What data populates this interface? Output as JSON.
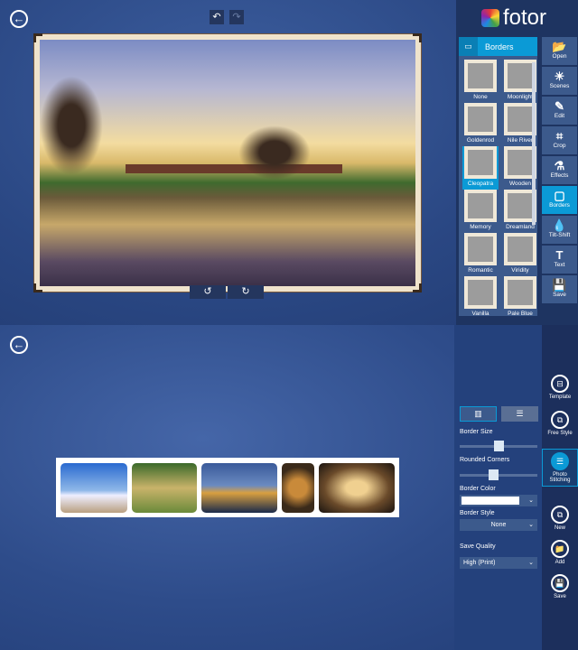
{
  "top": {
    "back_icon": "arrow-left",
    "brand": "fotor",
    "panel_title": "Borders",
    "borders": [
      {
        "label": "None"
      },
      {
        "label": "Moonlight"
      },
      {
        "label": "Goldenrod"
      },
      {
        "label": "Nile River"
      },
      {
        "label": "Cleopatra",
        "selected": true
      },
      {
        "label": "Wooden"
      },
      {
        "label": "Memory"
      },
      {
        "label": "Dreamland"
      },
      {
        "label": "Romantic"
      },
      {
        "label": "Viridity"
      },
      {
        "label": "Vanilla"
      },
      {
        "label": "Pale Blue"
      }
    ],
    "tools": [
      {
        "label": "Open",
        "icon": "📂"
      },
      {
        "label": "Scenes",
        "icon": "☀"
      },
      {
        "label": "Edit",
        "icon": "✎"
      },
      {
        "label": "Crop",
        "icon": "⌗"
      },
      {
        "label": "Effects",
        "icon": "⚗"
      },
      {
        "label": "Borders",
        "icon": "▢",
        "active": true
      },
      {
        "label": "Tilt-Shift",
        "icon": "💧"
      },
      {
        "label": "Text",
        "icon": "T"
      },
      {
        "label": "Save",
        "icon": "💾"
      }
    ]
  },
  "bottom": {
    "border_size_label": "Border Size",
    "border_size": 0.5,
    "rounded_label": "Rounded Corners",
    "rounded": 0.42,
    "border_color_label": "Border Color",
    "border_color": "#ffffff",
    "border_style_label": "Border Style",
    "border_style": "None",
    "save_quality_label": "Save Quality",
    "save_quality": "High (Print)",
    "modes": [
      {
        "label": "Template"
      },
      {
        "label": "Free Style"
      },
      {
        "label": "Photo Stitching",
        "active": true
      }
    ],
    "actions": [
      {
        "label": "New"
      },
      {
        "label": "Add"
      },
      {
        "label": "Save"
      }
    ]
  }
}
